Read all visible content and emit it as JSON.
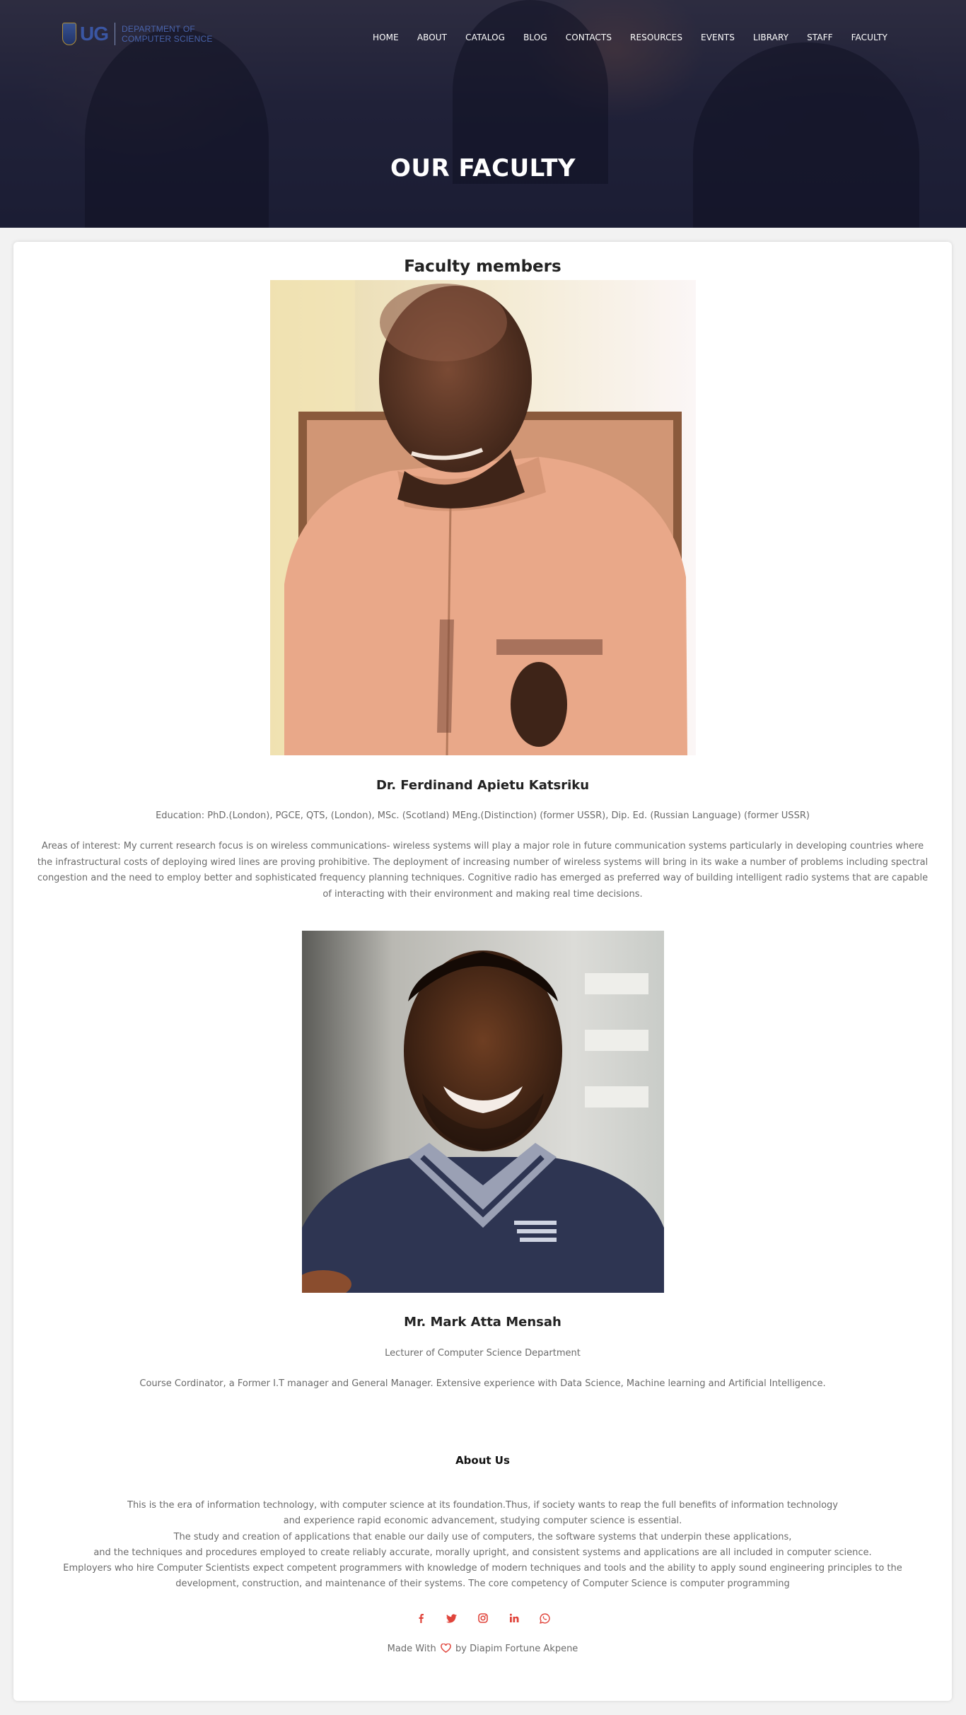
{
  "header": {
    "logo_abbr": "UG",
    "logo_line1": "DEPARTMENT OF",
    "logo_line2": "COMPUTER SCIENCE",
    "nav": [
      "HOME",
      "ABOUT",
      "CATALOG",
      "BLOG",
      "CONTACTS",
      "RESOURCES",
      "EVENTS",
      "LIBRARY",
      "STAFF",
      "FACULTY"
    ],
    "hero_title": "OUR FACULTY"
  },
  "main": {
    "section_title": "Faculty members",
    "faculty": [
      {
        "name": "Dr. Ferdinand Apietu Katsriku",
        "education": "Education: PhD.(London), PGCE, QTS, (London), MSc. (Scotland) MEng.(Distinction) (former USSR), Dip. Ed. (Russian Language) (former USSR)",
        "bio": "Areas of interest: My current research focus is on wireless communications- wireless systems will play a major role in future communication systems particularly in developing countries where the infrastructural costs of deploying wired lines are proving prohibitive. The deployment of increasing number of wireless systems will bring in its wake a number of problems including spectral congestion and the need to employ better and sophisticated frequency planning techniques. Cognitive radio has emerged as preferred way of building intelligent radio systems that are capable of interacting with their environment and making real time decisions."
      },
      {
        "name": "Mr. Mark Atta Mensah",
        "role": "Lecturer of Computer Science Department",
        "bio": "Course Cordinator, a Former I.T manager and General Manager. Extensive experience with Data Science, Machine learning and Artificial Intelligence."
      }
    ]
  },
  "footer": {
    "about_title": "About Us",
    "about_lines": [
      "This is the era of information technology, with computer science at its foundation.Thus, if society wants to reap the full benefits of information technology",
      "and experience rapid economic advancement, studying computer science is essential.",
      "The study and creation of applications that enable our daily use of computers, the software systems that underpin these applications,",
      "and the techniques and procedures employed to create reliably accurate, morally upright, and consistent systems and applications are all included in computer science.",
      "Employers who hire Computer Scientists expect competent programmers with knowledge of modern techniques and tools and the ability to apply sound engineering principles to the",
      "development, construction, and maintenance of their systems. The core competency of Computer Science is computer programming"
    ],
    "social_icons": [
      "facebook-icon",
      "twitter-icon",
      "instagram-icon",
      "linkedin-icon",
      "whatsapp-icon"
    ],
    "credit_prefix": "Made With",
    "credit_suffix": "by Diapim Fortune Akpene",
    "accent_color": "#e0443b"
  }
}
